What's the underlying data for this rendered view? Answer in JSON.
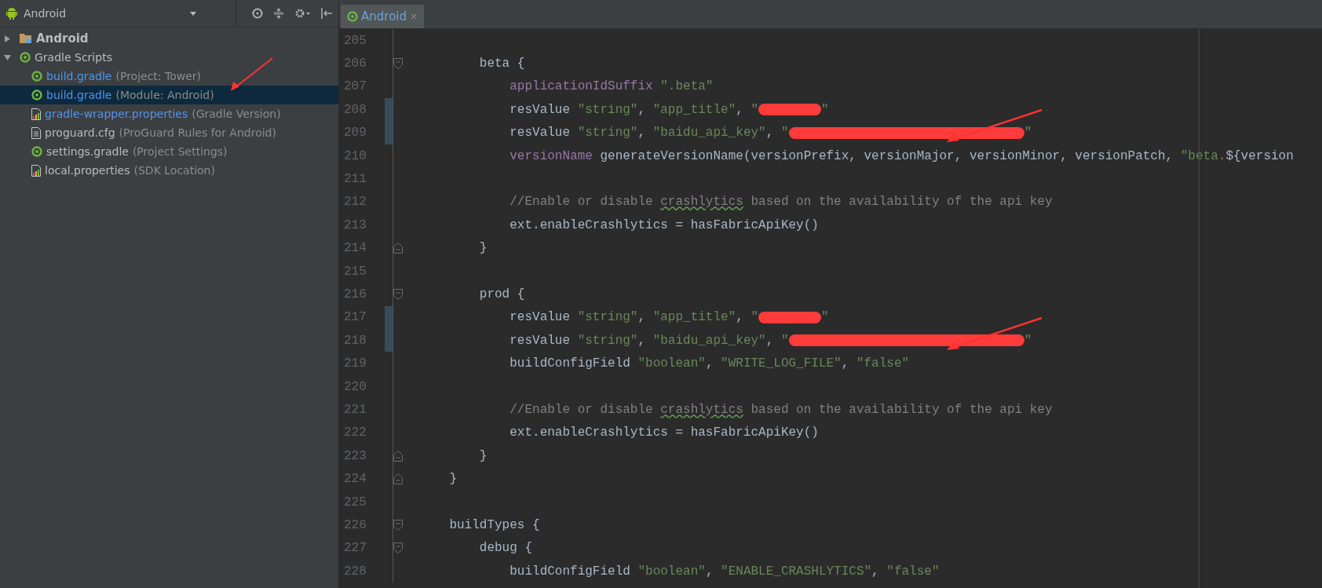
{
  "project_panel": {
    "view_selector": "Android",
    "tree": [
      {
        "label": "Android",
        "kind": "folder",
        "bold": true,
        "expanded": false,
        "selected": false
      },
      {
        "label": "Gradle Scripts",
        "kind": "gradle",
        "bold": false,
        "expanded": true,
        "selected": false,
        "children": [
          {
            "label": "build.gradle",
            "hint": "(Project: Tower)",
            "kind": "gradle",
            "color": "#5394ec",
            "selected": false,
            "annotated": false
          },
          {
            "label": "build.gradle",
            "hint": "(Module: Android)",
            "kind": "gradle",
            "color": "#5394ec",
            "selected": true,
            "annotated": true
          },
          {
            "label": "gradle-wrapper.properties",
            "hint": "(Gradle Version)",
            "kind": "properties",
            "color": "#5394ec",
            "selected": false,
            "annotated": false
          },
          {
            "label": "proguard.cfg",
            "hint": "(ProGuard Rules for Android)",
            "kind": "text",
            "color": "#bbbbbb",
            "selected": false,
            "annotated": false
          },
          {
            "label": "settings.gradle",
            "hint": "(Project Settings)",
            "kind": "gradle",
            "color": "#bbbbbb",
            "selected": false,
            "annotated": false
          },
          {
            "label": "local.properties",
            "hint": "(SDK Location)",
            "kind": "properties",
            "color": "#bbbbbb",
            "selected": false,
            "annotated": false
          }
        ]
      }
    ]
  },
  "editor": {
    "tabs": [
      {
        "label": "Android",
        "close": "×",
        "selected": true
      }
    ],
    "lines": [
      {
        "number": "205"
      },
      {
        "number": "206",
        "fold_start": true,
        "segments": [
          {
            "kind": "plain",
            "text": "        beta {"
          }
        ]
      },
      {
        "number": "207",
        "segments": [
          {
            "kind": "keyword",
            "text": "            applicationIdSuffix"
          },
          {
            "kind": "string",
            "text": " \".beta\""
          }
        ]
      },
      {
        "number": "208",
        "changed": true,
        "segments": [
          {
            "kind": "plain",
            "text": "            resValue "
          },
          {
            "kind": "string",
            "text": "\"string\""
          },
          {
            "kind": "plain",
            "text": ", "
          },
          {
            "kind": "string",
            "text": "\"app_title\""
          },
          {
            "kind": "plain",
            "text": ", "
          },
          {
            "kind": "string",
            "text": "\""
          },
          {
            "kind": "redaction",
            "long": false
          },
          {
            "kind": "string",
            "text": "\""
          }
        ]
      },
      {
        "number": "209",
        "changed": true,
        "annotated": true,
        "segments": [
          {
            "kind": "plain",
            "text": "            resValue "
          },
          {
            "kind": "string",
            "text": "\"string\""
          },
          {
            "kind": "plain",
            "text": ", "
          },
          {
            "kind": "string",
            "text": "\"baidu_api_key\""
          },
          {
            "kind": "plain",
            "text": ", "
          },
          {
            "kind": "string",
            "text": "\""
          },
          {
            "kind": "redaction",
            "long": true
          },
          {
            "kind": "string",
            "text": "\""
          }
        ]
      },
      {
        "number": "210",
        "segments": [
          {
            "kind": "keyword",
            "text": "            versionName"
          },
          {
            "kind": "plain",
            "text": " generateVersionName(versionPrefix, versionMajor, versionMinor, versionPatch, "
          },
          {
            "kind": "string",
            "text": "\"beta."
          },
          {
            "kind": "plain",
            "text": "${version"
          }
        ]
      },
      {
        "number": "211"
      },
      {
        "number": "212",
        "segments": [
          {
            "kind": "comment",
            "text": "            //Enable or disable "
          },
          {
            "kind": "comment",
            "text": "crashlytics",
            "typo": true
          },
          {
            "kind": "comment",
            "text": " based on the availability of the api key"
          }
        ]
      },
      {
        "number": "213",
        "segments": [
          {
            "kind": "plain",
            "text": "            ext.enableCrashlytics = hasFabricApiKey()"
          }
        ]
      },
      {
        "number": "214",
        "fold_end": true,
        "segments": [
          {
            "kind": "plain",
            "text": "        }"
          }
        ]
      },
      {
        "number": "215"
      },
      {
        "number": "216",
        "fold_start": true,
        "segments": [
          {
            "kind": "plain",
            "text": "        prod {"
          }
        ]
      },
      {
        "number": "217",
        "changed": true,
        "segments": [
          {
            "kind": "plain",
            "text": "            resValue "
          },
          {
            "kind": "string",
            "text": "\"string\""
          },
          {
            "kind": "plain",
            "text": ", "
          },
          {
            "kind": "string",
            "text": "\"app_title\""
          },
          {
            "kind": "plain",
            "text": ", "
          },
          {
            "kind": "string",
            "text": "\""
          },
          {
            "kind": "redaction",
            "long": false
          },
          {
            "kind": "string",
            "text": "\""
          }
        ]
      },
      {
        "number": "218",
        "changed": true,
        "annotated": true,
        "segments": [
          {
            "kind": "plain",
            "text": "            resValue "
          },
          {
            "kind": "string",
            "text": "\"string\""
          },
          {
            "kind": "plain",
            "text": ", "
          },
          {
            "kind": "string",
            "text": "\"baidu_api_key\""
          },
          {
            "kind": "plain",
            "text": ", "
          },
          {
            "kind": "string",
            "text": "\""
          },
          {
            "kind": "redaction",
            "long": true
          },
          {
            "kind": "string",
            "text": "\""
          }
        ]
      },
      {
        "number": "219",
        "segments": [
          {
            "kind": "plain",
            "text": "            buildConfigField "
          },
          {
            "kind": "string",
            "text": "\"boolean\""
          },
          {
            "kind": "plain",
            "text": ", "
          },
          {
            "kind": "string",
            "text": "\"WRITE_LOG_FILE\""
          },
          {
            "kind": "plain",
            "text": ", "
          },
          {
            "kind": "string",
            "text": "\"false\""
          }
        ]
      },
      {
        "number": "220"
      },
      {
        "number": "221",
        "segments": [
          {
            "kind": "comment",
            "text": "            //Enable or disable "
          },
          {
            "kind": "comment",
            "text": "crashlytics",
            "typo": true
          },
          {
            "kind": "comment",
            "text": " based on the availability of the api key"
          }
        ]
      },
      {
        "number": "222",
        "segments": [
          {
            "kind": "plain",
            "text": "            ext.enableCrashlytics = hasFabricApiKey()"
          }
        ]
      },
      {
        "number": "223",
        "fold_end": true,
        "segments": [
          {
            "kind": "plain",
            "text": "        }"
          }
        ]
      },
      {
        "number": "224",
        "fold_end": true,
        "segments": [
          {
            "kind": "plain",
            "text": "    }"
          }
        ]
      },
      {
        "number": "225"
      },
      {
        "number": "226",
        "fold_start": true,
        "segments": [
          {
            "kind": "plain",
            "text": "    buildTypes {"
          }
        ]
      },
      {
        "number": "227",
        "fold_start": true,
        "segments": [
          {
            "kind": "plain",
            "text": "        debug {"
          }
        ]
      },
      {
        "number": "228",
        "segments": [
          {
            "kind": "plain",
            "text": "            buildConfigField "
          },
          {
            "kind": "string",
            "text": "\"boolean\""
          },
          {
            "kind": "plain",
            "text": ", "
          },
          {
            "kind": "string",
            "text": "\"ENABLE_CRASHLYTICS\""
          },
          {
            "kind": "plain",
            "text": ", "
          },
          {
            "kind": "string",
            "text": "\"false\""
          }
        ]
      }
    ]
  }
}
